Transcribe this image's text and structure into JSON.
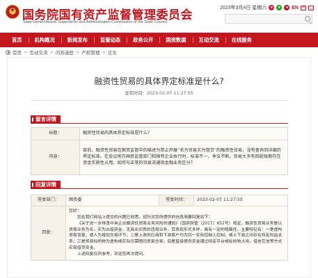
{
  "header": {
    "title": "国务院国有资产监督管理委员会",
    "subtitle": "State-owned Assets Supervision and Administration Commission of the State Council",
    "date": "2023年3月4日 星期六",
    "lang": "EN",
    "search": {
      "placeholder": "",
      "icon": "search-icon"
    },
    "icons": [
      "weibo-icon",
      "wechat-icon",
      "user-icon",
      "mail-icon",
      "app-icon"
    ]
  },
  "nav": {
    "items": [
      "首页",
      "机构概况",
      "新闻发布",
      "监管动态",
      "政务公开",
      "国资数据",
      "互动交流",
      "在线服务"
    ]
  },
  "breadcrumb": {
    "items": [
      "首页",
      "互动交流",
      "问答选登",
      "产权管理",
      "正文"
    ]
  },
  "article": {
    "title": "融资性贸易的具体界定标准是什么?",
    "pub_time": "发布时间：2023-02-07 11:27:55"
  },
  "message": {
    "section_label": "留言详情",
    "title_label": "标题：",
    "title_value": "融资性贸易的具体界定标准是什么?",
    "content_label": "内容：",
    "content_value": "目前，融资性贸易在国资监管中的描述为禁止开展“名为贸易实为借贷”的融资性贸易，没有查询到详细的界定标准。在会议地方国资监管部门和国有企业执行时，标准不一，争议不断。贸易大多有回款账期存在资金实质性占用，如何与正常的贸易流通现金融业务区分？"
  },
  "reply": {
    "section_label": "回复详情",
    "dept_label": "答复部门：",
    "dept_value": "国资委",
    "time_label": "答复时间：",
    "time_value": "2023-02-07 11:27:55",
    "answer_label": "回复：",
    "greeting": "您好：",
    "para1": "您在我们网站上提交的问题已收悉，现针对您所提供的信息简要回复如下：",
    "para2": "《关于进一步排查中央企业融资性贸易业务风险的通知》（国资财管〔2017〕652号）规定，融资性贸易业务是以贸易业务为名，实为出借资金、无商业实质的违规业务，其表现形式多样，具有一定的隐蔽性，主要特征有：一是虚构贸易背景，或人为增加交易环节；二是上游供应商和下游客户均为同一实际控制人控制，或上下游之间存在特定利益关系；三是贸易标的物为虚构或实际仅需随同贸易交易；四是直接提供资金通过特定平台或标的物占用，借信互信等方式实现借贷资金。",
    "closing": "上述回复仅供参考，欢迎您再次提问。"
  },
  "colors": {
    "brand_red": "#c4161c",
    "label_bg": "#f6f2ea",
    "table_border": "#e0d6c8"
  }
}
